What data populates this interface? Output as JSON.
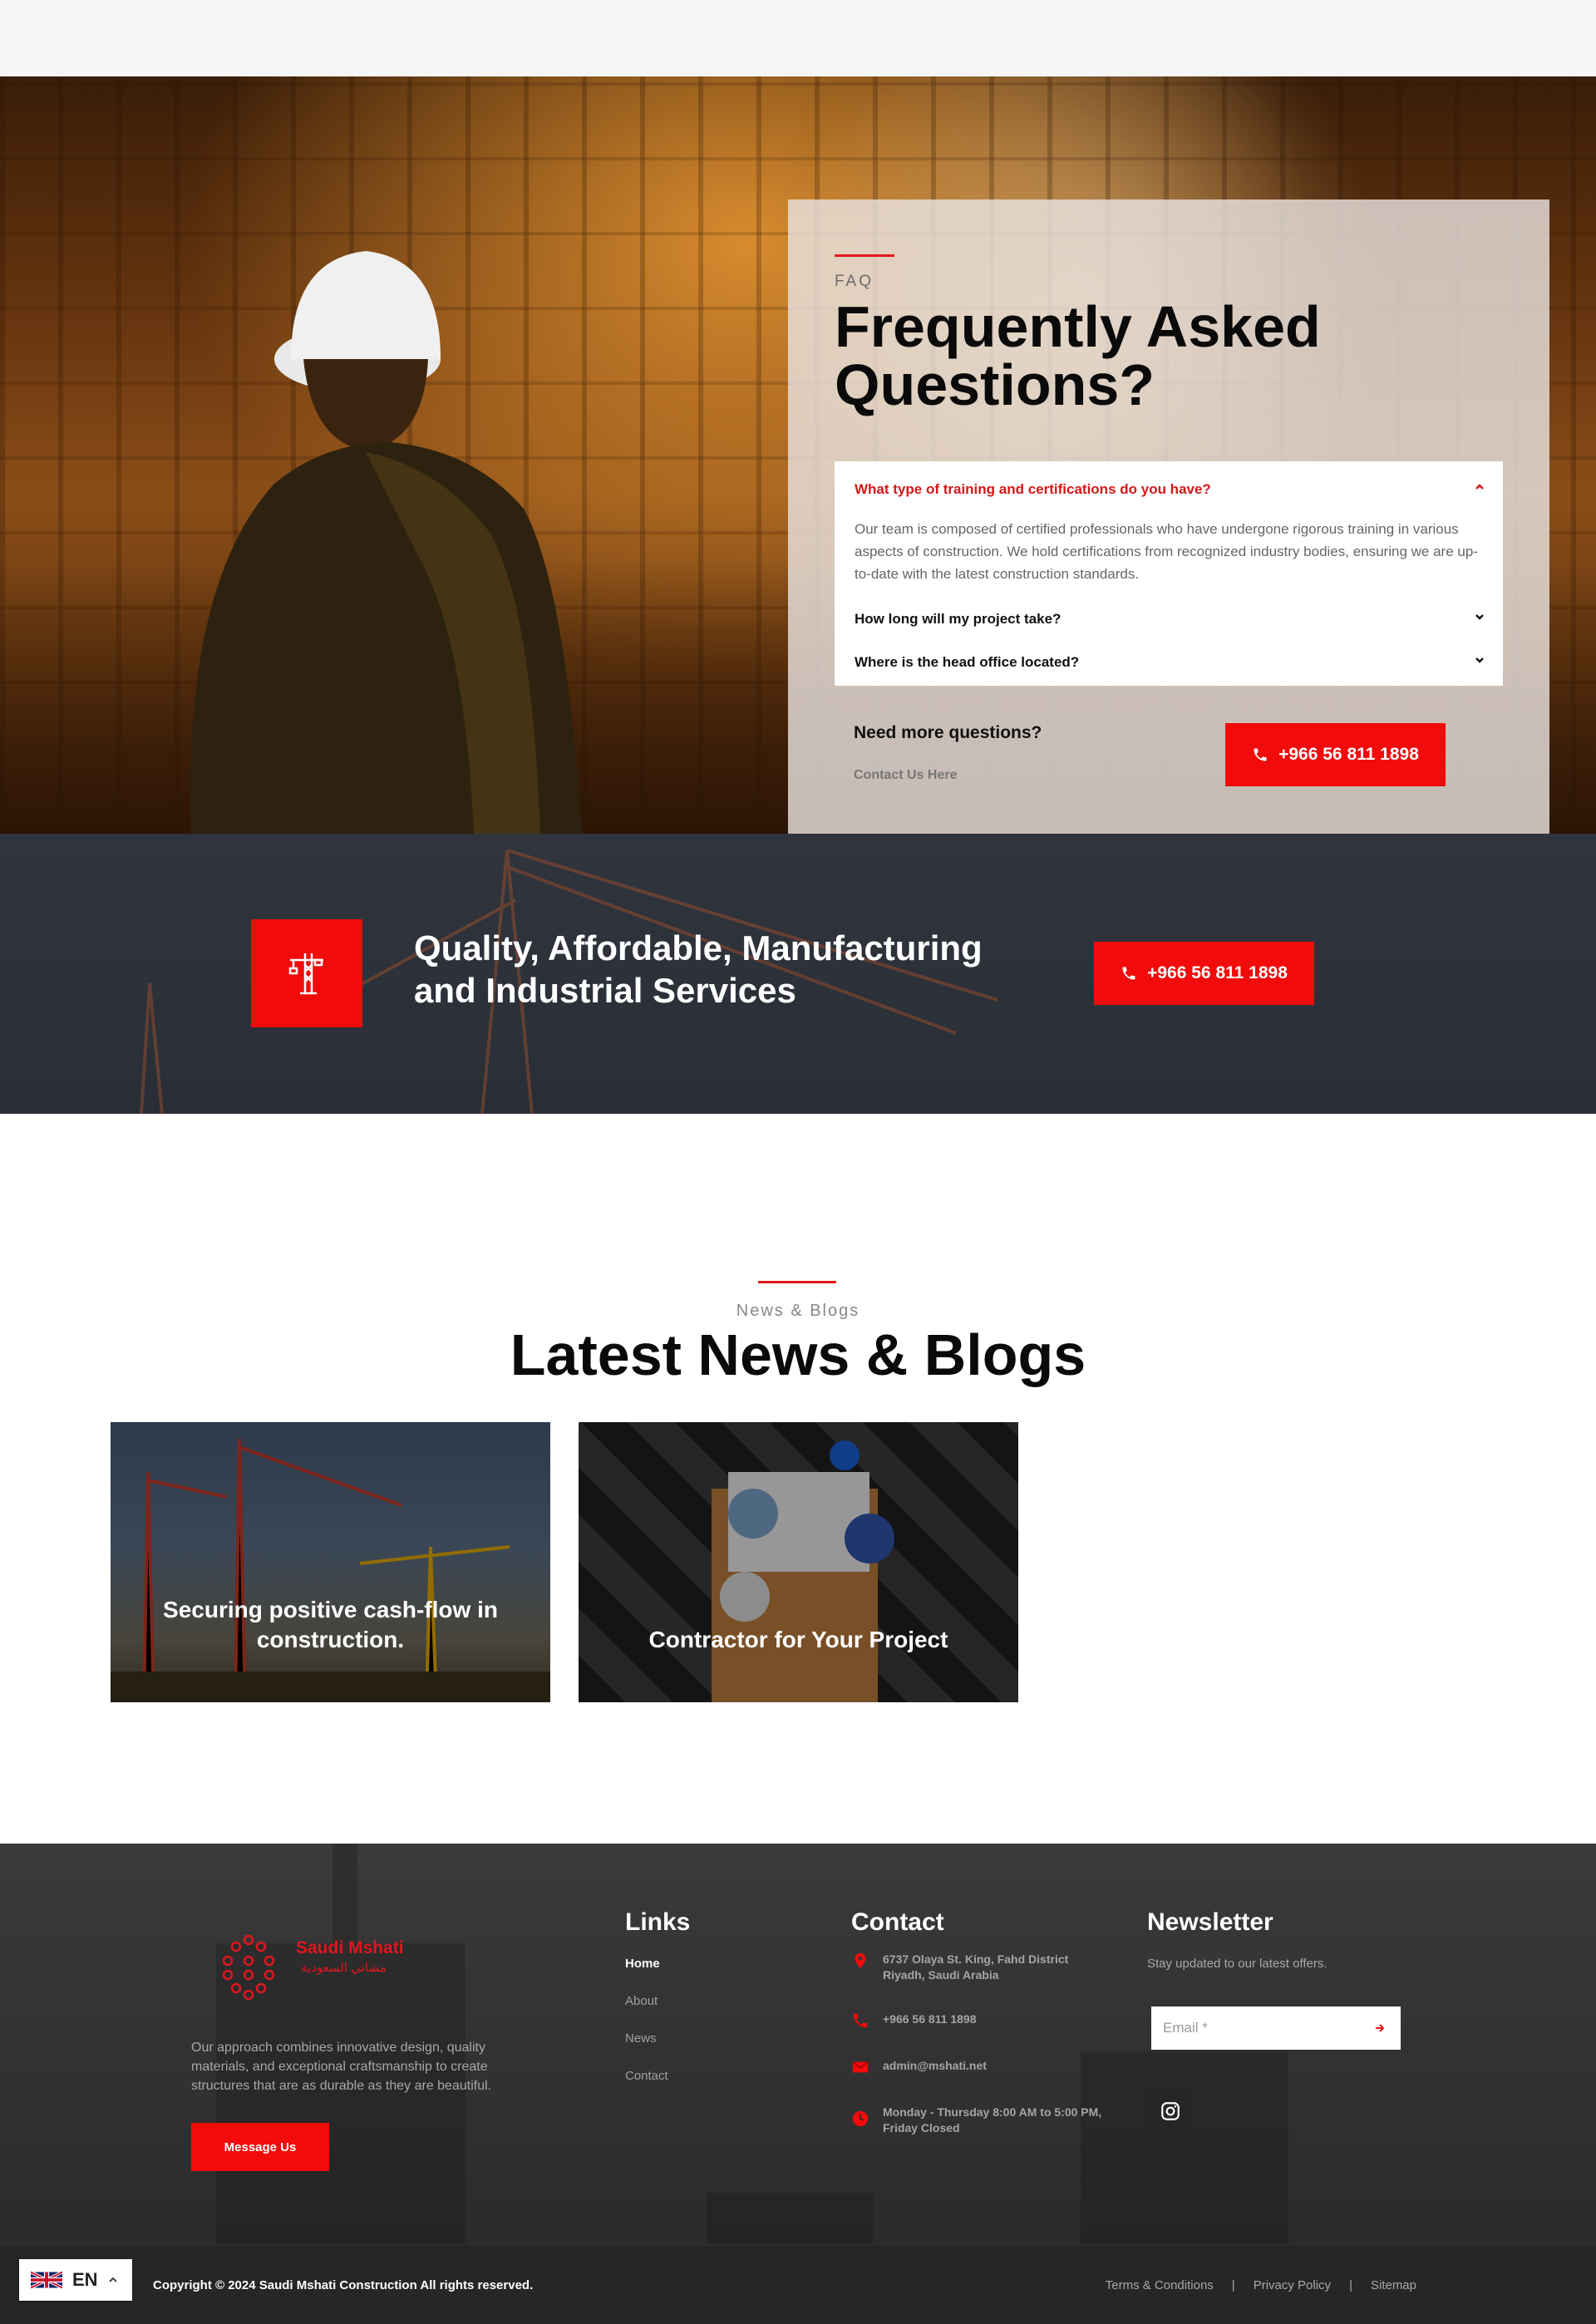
{
  "faq": {
    "eyebrow": "FAQ",
    "title": "Frequently Asked Questions?",
    "items": [
      {
        "question": "What type of training and certifications do you have?",
        "answer": "Our team is composed of certified professionals who have undergone rigorous training in various aspects of construction. We hold certifications from recognized industry bodies, ensuring we are up-to-date with the latest construction standards.",
        "expanded": true
      },
      {
        "question": "How long will my project take?",
        "expanded": false
      },
      {
        "question": "Where is the head office located?",
        "expanded": false
      }
    ],
    "more_text": "Need more questions?",
    "contact_link": "Contact Us Here",
    "phone_button": "+966 56 811 1898"
  },
  "cta": {
    "title": "Quality, Affordable, Manufacturing and Industrial Services",
    "phone_button": "+966 56 811 1898",
    "icon": "crane-icon"
  },
  "news": {
    "eyebrow": "News & Blogs",
    "title": "Latest News & Blogs",
    "posts": [
      {
        "title": "Securing positive cash-flow in construction."
      },
      {
        "title": "Contractor for Your Project"
      }
    ]
  },
  "footer": {
    "logo_text": "Saudi Mshati",
    "logo_arabic": "مشاتي السعودية",
    "description": "Our approach combines innovative design, quality materials, and exceptional craftsmanship to create structures that are as durable as they are beautiful.",
    "message_button": "Message Us",
    "links_heading": "Links",
    "links": [
      "Home",
      "About",
      "News",
      "Contact"
    ],
    "contact_heading": "Contact",
    "contact": {
      "address": "6737 Olaya St. King, Fahd District Riyadh, Saudi Arabia",
      "phone": "+966 56 811 1898",
      "email": "admin@mshati.net",
      "hours": "Monday - Thursday 8:00 AM to 5:00 PM, Friday Closed"
    },
    "newsletter_heading": "Newsletter",
    "newsletter_sub": "Stay updated to our latest offers.",
    "email_placeholder": "Email *"
  },
  "bottom": {
    "copyright": "Copyright © 2024 Saudi Mshati Construction All rights reserved.",
    "legal": [
      "Terms & Conditions",
      "Privacy Policy",
      "Sitemap"
    ],
    "separator": "|",
    "language": "EN"
  },
  "colors": {
    "accent": "#f10b0b",
    "dark": "#2b2b2b"
  }
}
